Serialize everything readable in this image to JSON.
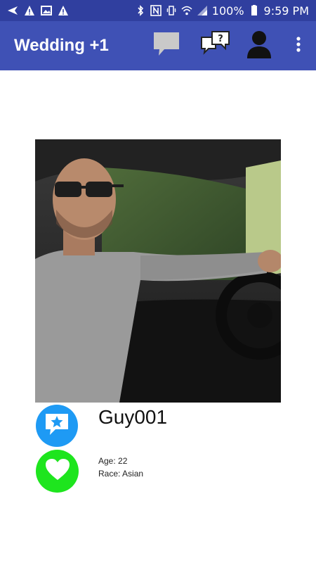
{
  "status_bar": {
    "battery": "100%",
    "time": "9:59 PM"
  },
  "app_bar": {
    "title": "Wedding +1",
    "actions": [
      {
        "name": "chat-bubble-icon"
      },
      {
        "name": "question-chat-icon"
      },
      {
        "name": "profile-icon"
      },
      {
        "name": "overflow-menu-icon"
      }
    ]
  },
  "profile": {
    "name": "Guy001",
    "age": "Age: 22",
    "race": "Race: Asian"
  },
  "colors": {
    "status_bar": "#303f9f",
    "app_bar": "#3f51b5",
    "chat_button": "#1e9af4",
    "like_button": "#1ee51e"
  }
}
